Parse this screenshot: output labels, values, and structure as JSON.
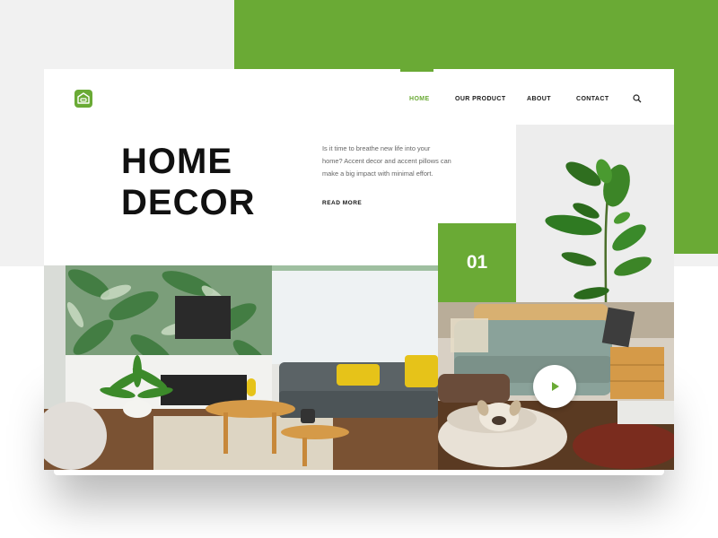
{
  "brand": {
    "logo_icon": "sofa-icon",
    "accent_color": "#6aaa35"
  },
  "nav": {
    "items": [
      {
        "label": "HOME",
        "active": true
      },
      {
        "label": "OUR PRODUCT",
        "active": false
      },
      {
        "label": "ABOUT",
        "active": false
      },
      {
        "label": "CONTACT",
        "active": false
      }
    ],
    "search_icon": "search-icon"
  },
  "hero": {
    "title_line1": "HOME",
    "title_line2": "DECOR",
    "description_line1": "Is it time to breathe new life into your",
    "description_line2": "home? Accent decor and accent pillows can",
    "description_line3": "make a big impact with minimal effort.",
    "read_more": "READ MORE"
  },
  "slide": {
    "number": "01"
  },
  "media": {
    "play_icon": "play-icon"
  }
}
